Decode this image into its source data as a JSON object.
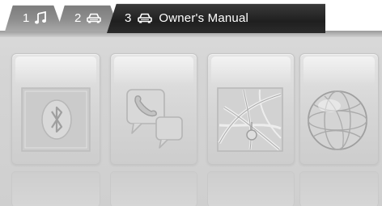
{
  "tabs": [
    {
      "number": "1",
      "icon": "music-note-icon"
    },
    {
      "number": "2",
      "icon": "car-icon"
    },
    {
      "number": "3",
      "icon": "car-icon",
      "label": "Owner's Manual"
    }
  ],
  "tiles": [
    {
      "icon": "bluetooth-icon"
    },
    {
      "icon": "phone-chat-icon"
    },
    {
      "icon": "navigation-map-icon"
    },
    {
      "icon": "internet-globe-icon"
    }
  ],
  "colors": {
    "active_tab": "#2b2b2b",
    "inactive_tab": "#8e8e8e",
    "background": "#d4d4d4",
    "tab_text": "#ffffff"
  }
}
